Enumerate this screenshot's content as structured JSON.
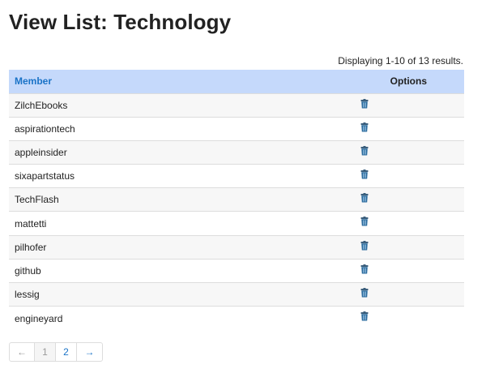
{
  "page": {
    "title": "View List: Technology",
    "summary": "Displaying 1-10 of 13 results."
  },
  "table": {
    "headers": {
      "member": "Member",
      "options": "Options"
    },
    "rows": [
      {
        "member": "ZilchEbooks",
        "action_icon": "delete-trash-icon"
      },
      {
        "member": "aspirationtech",
        "action_icon": "delete-trash-icon"
      },
      {
        "member": "appleinsider",
        "action_icon": "delete-trash-icon"
      },
      {
        "member": "sixapartstatus",
        "action_icon": "delete-trash-icon"
      },
      {
        "member": "TechFlash",
        "action_icon": "delete-trash-icon"
      },
      {
        "member": "mattetti",
        "action_icon": "delete-trash-icon"
      },
      {
        "member": "pilhofer",
        "action_icon": "delete-trash-icon"
      },
      {
        "member": "github",
        "action_icon": "delete-trash-icon"
      },
      {
        "member": "lessig",
        "action_icon": "delete-trash-icon"
      },
      {
        "member": "engineyard",
        "action_icon": "delete-trash-icon"
      }
    ]
  },
  "pagination": {
    "prev": "←",
    "pages": [
      "1",
      "2"
    ],
    "current": "1",
    "next": "→"
  },
  "colors": {
    "header_bg": "#c5d9fb",
    "link": "#1a73c7",
    "row_alt": "#f7f7f7",
    "icon": "#2a6a9c"
  }
}
